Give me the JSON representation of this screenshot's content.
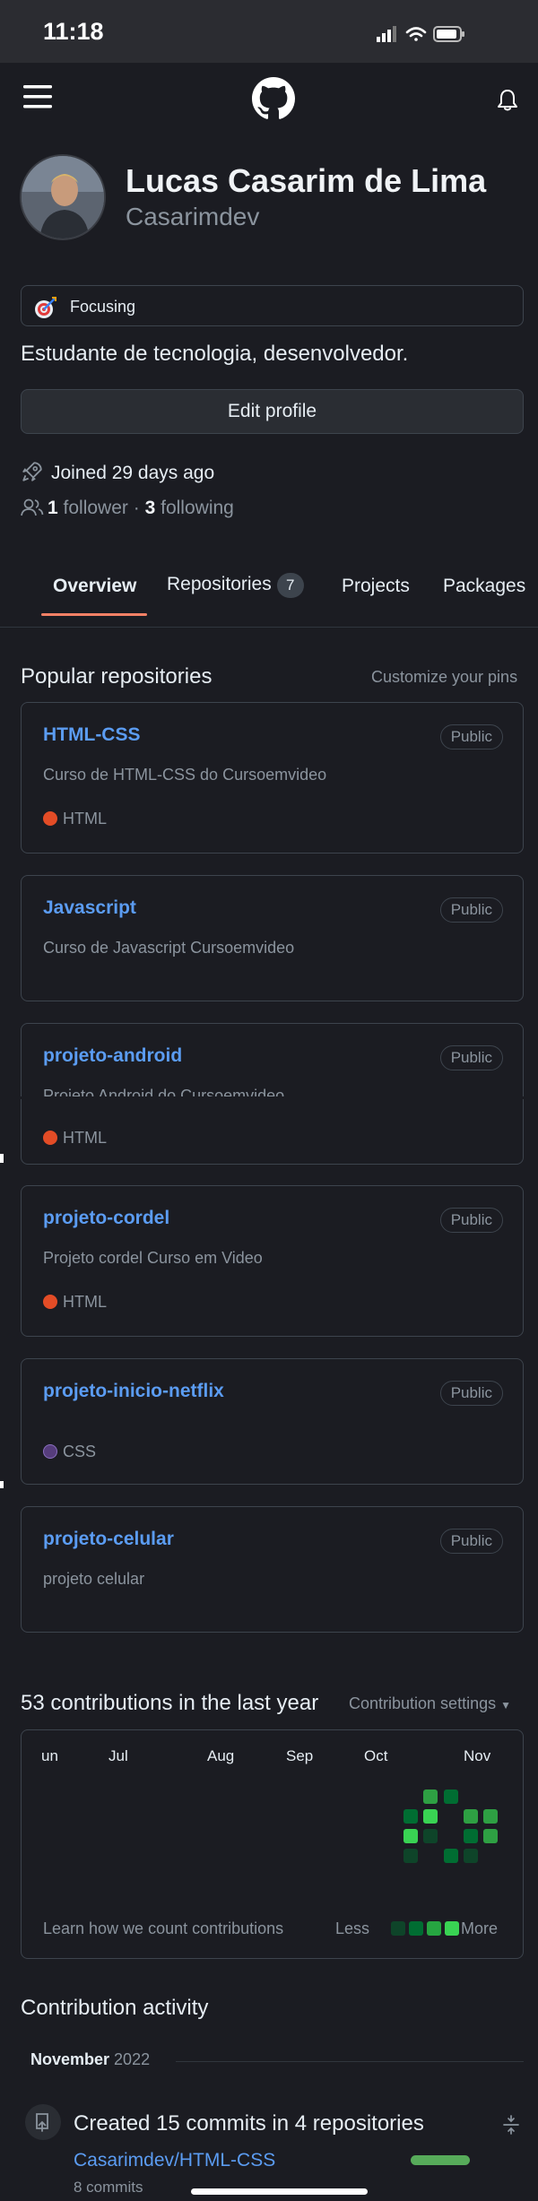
{
  "status_bar": {
    "time": "11:18"
  },
  "profile": {
    "name": "Lucas Casarim de Lima",
    "username": "Casarimdev",
    "status": "Focusing",
    "bio": "Estudante de tecnologia, desenvolvedor.",
    "edit_button": "Edit profile",
    "joined": "Joined 29 days ago",
    "followers_count": "1",
    "followers_label": "follower",
    "separator": "·",
    "following_count": "3",
    "following_label": "following"
  },
  "tabs": [
    {
      "label": "Overview",
      "active": true
    },
    {
      "label": "Repositories",
      "count": "7"
    },
    {
      "label": "Projects"
    },
    {
      "label": "Packages"
    }
  ],
  "popular": {
    "title": "Popular repositories",
    "customize": "Customize your pins",
    "repos": [
      {
        "name": "HTML-CSS",
        "visibility": "Public",
        "description": "Curso de HTML-CSS do Cursoemvideo",
        "language": "HTML",
        "language_color": "#e34c26"
      },
      {
        "name": "Javascript",
        "visibility": "Public",
        "description": "Curso de Javascript Cursoemvideo"
      },
      {
        "name": "projeto-android",
        "visibility": "Public",
        "description": "Projeto Android do Cursoemvideo",
        "language": "HTML",
        "language_color": "#e34c26"
      },
      {
        "name": "projeto-cordel",
        "visibility": "Public",
        "description": "Projeto cordel Curso em Video",
        "language": "HTML",
        "language_color": "#e34c26"
      },
      {
        "name": "projeto-inicio-netflix",
        "visibility": "Public",
        "language": "CSS",
        "language_color": "#563d7c"
      },
      {
        "name": "projeto-celular",
        "visibility": "Public",
        "description": "projeto celular"
      }
    ]
  },
  "contributions": {
    "title": "53 contributions in the last year",
    "settings": "Contribution settings",
    "months": [
      "un",
      "Jul",
      "Aug",
      "Sep",
      "Oct",
      "Nov"
    ],
    "learn": "Learn how we count contributions",
    "less": "Less",
    "more": "More",
    "colors": {
      "l1": "#0e4429",
      "l2": "#006d32",
      "l3": "#26a641",
      "l4": "#39d353",
      "mid": "#2ea043"
    }
  },
  "activity": {
    "title": "Contribution activity",
    "month": "November",
    "year": "2022",
    "event_title": "Created 15 commits in 4 repositories",
    "event_repo": "Casarimdev/HTML-CSS",
    "event_commits": "8 commits"
  }
}
